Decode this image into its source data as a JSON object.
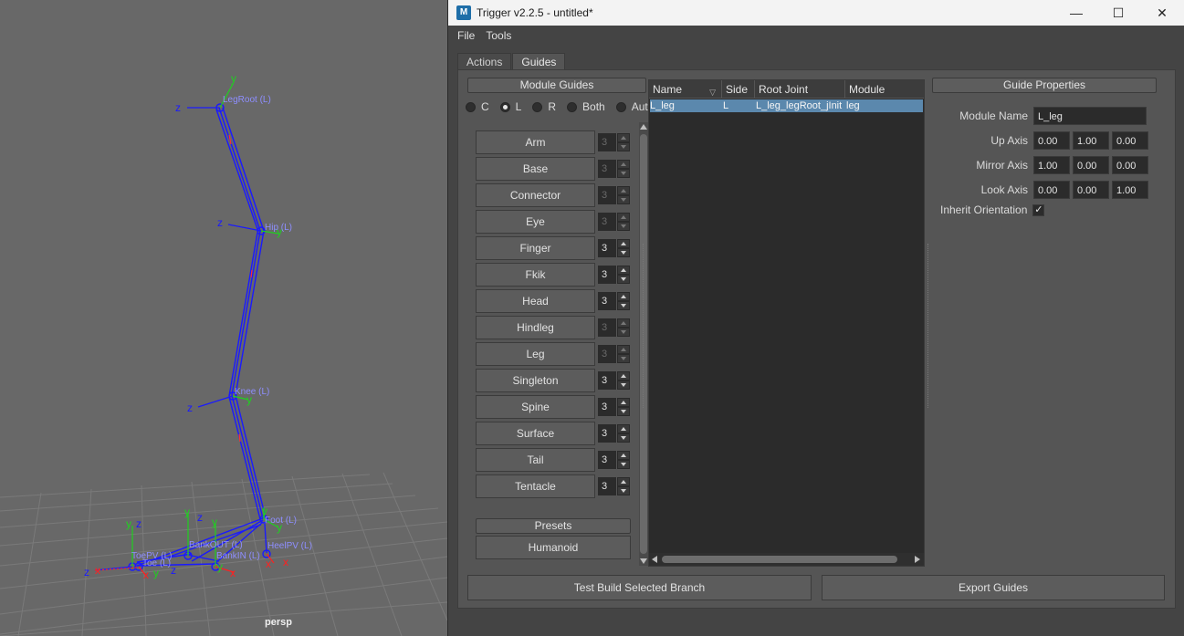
{
  "viewport": {
    "camera_label": "persp",
    "joint_labels": {
      "legroot": "LegRoot (L)",
      "hip": "Hip (L)",
      "knee": "Knee (L)",
      "foot": "Foot (L)",
      "heelpv": "HeelPV (L)",
      "bankout": "BankOUT (L)",
      "bankin": "BankIN (L)",
      "toepv": "ToePV (L)",
      "toe": "Toe (L)"
    },
    "axis": {
      "x": "x",
      "y": "y",
      "z": "z"
    }
  },
  "window": {
    "title": "Trigger v2.2.5 - untitled*",
    "app_icon_text": "M",
    "min_glyph": "—",
    "max_glyph": "☐",
    "close_glyph": "✕"
  },
  "menu": [
    "File",
    "Tools"
  ],
  "tabs": [
    {
      "label": "Actions",
      "active": false
    },
    {
      "label": "Guides",
      "active": true
    }
  ],
  "module_guides": {
    "header": "Module Guides",
    "side_options": [
      {
        "label": "C",
        "checked": false
      },
      {
        "label": "L",
        "checked": true
      },
      {
        "label": "R",
        "checked": false
      },
      {
        "label": "Both",
        "checked": false
      },
      {
        "label": "Auto",
        "checked": false
      }
    ],
    "modules": [
      {
        "label": "Arm",
        "count": "3",
        "enabled": false
      },
      {
        "label": "Base",
        "count": "3",
        "enabled": false
      },
      {
        "label": "Connector",
        "count": "3",
        "enabled": false
      },
      {
        "label": "Eye",
        "count": "3",
        "enabled": false
      },
      {
        "label": "Finger",
        "count": "3",
        "enabled": true
      },
      {
        "label": "Fkik",
        "count": "3",
        "enabled": true
      },
      {
        "label": "Head",
        "count": "3",
        "enabled": true
      },
      {
        "label": "Hindleg",
        "count": "3",
        "enabled": false
      },
      {
        "label": "Leg",
        "count": "3",
        "enabled": false
      },
      {
        "label": "Singleton",
        "count": "3",
        "enabled": true
      },
      {
        "label": "Spine",
        "count": "3",
        "enabled": true
      },
      {
        "label": "Surface",
        "count": "3",
        "enabled": true
      },
      {
        "label": "Tail",
        "count": "3",
        "enabled": true
      },
      {
        "label": "Tentacle",
        "count": "3",
        "enabled": true
      }
    ],
    "presets_header": "Presets",
    "presets": [
      "Humanoid"
    ]
  },
  "guide_table": {
    "columns": [
      "Name",
      "Side",
      "Root Joint",
      "Module"
    ],
    "rows": [
      {
        "name": "L_leg",
        "side": "L",
        "root_joint": "L_leg_legRoot_jInit",
        "module": "leg"
      }
    ]
  },
  "guide_properties": {
    "header": "Guide Properties",
    "module_name_label": "Module Name",
    "module_name_value": "L_leg",
    "up_axis_label": "Up Axis",
    "up_axis": [
      "0.00",
      "1.00",
      "0.00"
    ],
    "mirror_axis_label": "Mirror Axis",
    "mirror_axis": [
      "1.00",
      "0.00",
      "0.00"
    ],
    "look_axis_label": "Look Axis",
    "look_axis": [
      "0.00",
      "0.00",
      "1.00"
    ],
    "inherit_label": "Inherit Orientation",
    "inherit_checked": true,
    "check_glyph": "✓"
  },
  "bottom_buttons": {
    "test_build": "Test Build Selected Branch",
    "export": "Export Guides"
  },
  "colors": {
    "joint": "#1a1aff",
    "joint_label": "#8e8eff",
    "selection": "#5b88ad"
  }
}
